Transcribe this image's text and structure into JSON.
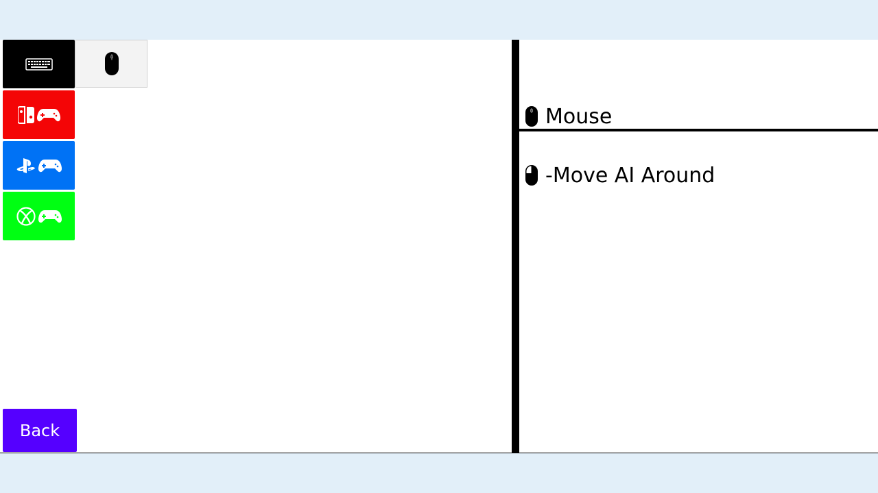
{
  "device_tabs": [
    {
      "id": "keyboard",
      "icons": [
        "keyboard-icon"
      ],
      "color": "#000000"
    },
    {
      "id": "switch",
      "icons": [
        "nintendo-switch-icon",
        "gamepad-icon"
      ],
      "color": "#f40506"
    },
    {
      "id": "playstation",
      "icons": [
        "playstation-icon",
        "gamepad-icon"
      ],
      "color": "#0072f5"
    },
    {
      "id": "xbox",
      "icons": [
        "xbox-icon",
        "gamepad-icon"
      ],
      "color": "#00ff12"
    }
  ],
  "sub_tabs": [
    {
      "id": "mouse",
      "icon": "mouse-icon",
      "selected": true
    }
  ],
  "back_button": {
    "label": "Back",
    "color": "#5500ff"
  },
  "panel": {
    "title": "Mouse",
    "title_icon": "mouse-icon",
    "bindings": [
      {
        "icon": "mouse-left-click-icon",
        "text": "-Move AI Around"
      }
    ]
  },
  "colors": {
    "page_background": "#e2eff9",
    "content_background": "#ffffff"
  }
}
